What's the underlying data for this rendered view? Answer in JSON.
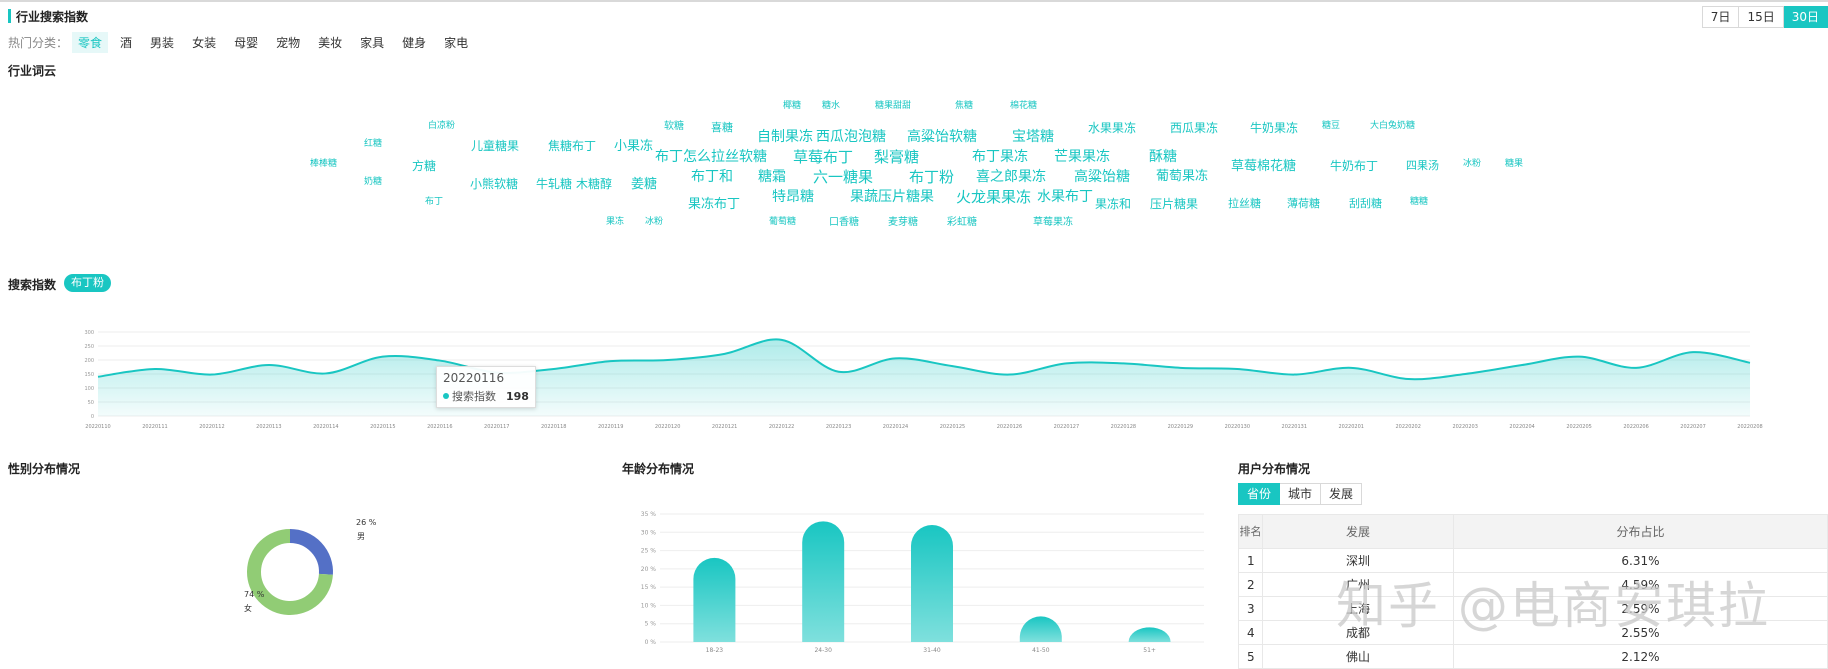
{
  "header": {
    "title": "行业搜索指数",
    "ranges": [
      "7日",
      "15日",
      "30日"
    ],
    "active_range": "30日"
  },
  "categories": {
    "label": "热门分类：",
    "items": [
      "零食",
      "酒",
      "男装",
      "女装",
      "母婴",
      "宠物",
      "美妆",
      "家具",
      "健身",
      "家电"
    ],
    "active": "零食"
  },
  "word_cloud": {
    "title": "行业词云",
    "words": [
      "椰糖",
      "糖水",
      "糖果甜甜",
      "焦糖",
      "棉花糖",
      "白凉粉",
      "软糖",
      "喜糖",
      "自制果冻",
      "西瓜泡泡糖",
      "高粱饴软糖",
      "宝塔糖",
      "水果果冻",
      "西瓜果冻",
      "牛奶果冻",
      "糖豆",
      "大白兔奶糖",
      "红糖",
      "儿童糖果",
      "焦糖布丁",
      "小果冻",
      "布丁怎么拉丝软糖",
      "草莓布丁",
      "梨膏糖",
      "布丁果冻",
      "芒果果冻",
      "酥糖",
      "草莓棉花糖",
      "牛奶布丁",
      "四果汤",
      "冰粉",
      "糖果",
      "棒棒糖",
      "方糖",
      "布丁和",
      "糖霜",
      "六一糖果",
      "布丁粉",
      "喜之郎果冻",
      "高粱饴糖",
      "葡萄果冻",
      "奶糖",
      "小熊软糖",
      "牛轧糖",
      "木糖醇",
      "姜糖",
      "特昂糖",
      "果蔬压片糖果",
      "火龙果果冻",
      "水果布丁",
      "布丁",
      "果冻布丁",
      "果冻和",
      "压片糖果",
      "拉丝糖",
      "薄荷糖",
      "刮刮糖",
      "糖糖",
      "果冻",
      "冰粉",
      "葡萄糖",
      "口香糖",
      "麦芽糖",
      "彩虹糖",
      "草莓果冻"
    ]
  },
  "search_index": {
    "title": "搜索指数",
    "keyword": "布丁粉",
    "tooltip": {
      "date": "20220116",
      "label": "搜索指数",
      "value": "198"
    }
  },
  "chart_data": [
    {
      "type": "area",
      "title": "",
      "x": [
        "20220110",
        "20220111",
        "20220112",
        "20220113",
        "20220114",
        "20220115",
        "20220116",
        "20220117",
        "20220118",
        "20220119",
        "20220120",
        "20220121",
        "20220122",
        "20220123",
        "20220124",
        "20220125",
        "20220126",
        "20220127",
        "20220128",
        "20220129",
        "20220130",
        "20220131",
        "20220201",
        "20220202",
        "20220203",
        "20220204",
        "20220205",
        "20220206",
        "20220207",
        "20220208"
      ],
      "series": [
        {
          "values": [
            140,
            168,
            148,
            182,
            152,
            212,
            198,
            155,
            168,
            196,
            200,
            222,
            272,
            158,
            206,
            178,
            148,
            188,
            188,
            172,
            168,
            148,
            172,
            132,
            150,
            182,
            212,
            172,
            228,
            190
          ]
        }
      ],
      "yticks": [
        0,
        50,
        100,
        150,
        200,
        250,
        300
      ],
      "ylim": [
        0,
        300
      ],
      "grid": true
    },
    {
      "type": "pie",
      "labels": [
        "男",
        "女"
      ],
      "values": [
        26,
        74
      ],
      "value_labels": [
        "26 %",
        "74 %"
      ],
      "colors": [
        "#5470c6",
        "#91cc75"
      ]
    },
    {
      "type": "bar",
      "categories": [
        "18-23",
        "24-30",
        "31-40",
        "41-50",
        "51+"
      ],
      "values": [
        23,
        33,
        32,
        7,
        4
      ],
      "yticks": [
        "0 %",
        "5 %",
        "10 %",
        "15 %",
        "20 %",
        "25 %",
        "30 %",
        "35 %"
      ],
      "ylim": [
        0,
        35
      ],
      "grid": true
    }
  ],
  "gender": {
    "title": "性别分布情况"
  },
  "age": {
    "title": "年龄分布情况"
  },
  "users": {
    "title": "用户分布情况",
    "tabs": [
      "省份",
      "城市",
      "发展"
    ],
    "active_tab": "省份",
    "columns": [
      "排名",
      "发展",
      "分布占比"
    ],
    "rows": [
      {
        "rank": "1",
        "name": "深圳",
        "share": "6.31%"
      },
      {
        "rank": "2",
        "name": "广州",
        "share": "4.59%"
      },
      {
        "rank": "3",
        "name": "上海",
        "share": "2.59%"
      },
      {
        "rank": "4",
        "name": "成都",
        "share": "2.55%"
      },
      {
        "rank": "5",
        "name": "佛山",
        "share": "2.12%"
      }
    ]
  },
  "watermark": "知乎 @电商安琪拉",
  "colors": {
    "accent": "#19c6c2",
    "male": "#5470c6",
    "female": "#91cc75"
  }
}
